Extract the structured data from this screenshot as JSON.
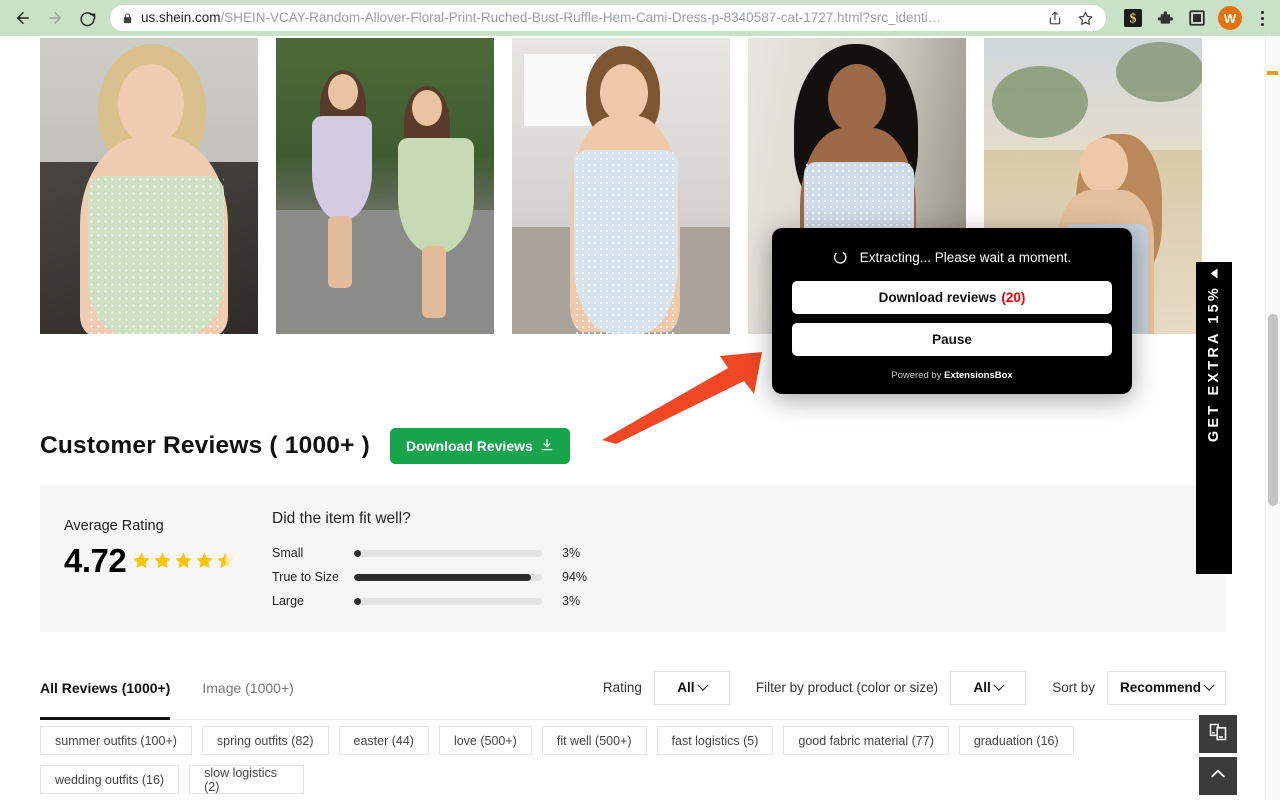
{
  "browser": {
    "back_icon": "back-arrow-icon",
    "forward_icon": "forward-arrow-icon",
    "reload_icon": "reload-icon",
    "lock_icon": "lock-icon",
    "url_domain": "us.shein.com",
    "url_path": "/SHEIN-VCAY-Random-Allover-Floral-Print-Ruched-Bust-Ruffle-Hem-Cami-Dress-p-8340587-cat-1727.html?src_identi…",
    "share_icon": "share-icon",
    "bookmark_icon": "star-icon",
    "extensions": [
      {
        "name": "money-extension-icon",
        "glyph": "$"
      },
      {
        "name": "puzzle-extensions-icon",
        "glyph": "puzzle"
      },
      {
        "name": "side-panel-icon",
        "glyph": "square"
      }
    ],
    "profile_initial": "W",
    "menu_icon": "kebab-menu-icon"
  },
  "gallery": {
    "photos": [
      {
        "name": "review-photo-1",
        "alt": "Blonde woman in sage floral cami dress indoors"
      },
      {
        "name": "review-photo-2",
        "alt": "Two women walking on road in floral dresses"
      },
      {
        "name": "review-photo-3",
        "alt": "Woman in light blue floral dress indoors"
      },
      {
        "name": "review-photo-4",
        "alt": "Dark haired model in light blue floral dress"
      },
      {
        "name": "review-photo-5",
        "alt": "Woman in field at golden hour"
      }
    ]
  },
  "extension_popup": {
    "spinner_icon": "loading-spinner-icon",
    "status": "Extracting... Please wait a moment.",
    "download_label": "Download reviews",
    "download_count": "(20)",
    "pause_label": "Pause",
    "footer_prefix": "Powered by ",
    "footer_brand": "ExtensionsBox",
    "background": "#000000",
    "count_color": "#ee0000"
  },
  "annotation": {
    "arrow_name": "red-pointer-arrow",
    "color": "#f04824"
  },
  "reviews": {
    "title": "Customer Reviews ( 1000+ )",
    "download_button": "Download Reviews",
    "download_icon": "download-icon",
    "download_button_color": "#17a44c",
    "average": {
      "label": "Average Rating",
      "value": "4.72",
      "stars_filled": 4,
      "stars_half": 1,
      "stars_total": 5,
      "star_color": "#ffc400"
    },
    "fit": {
      "question": "Did the item fit well?",
      "rows": [
        {
          "label": "Small",
          "percent": 3,
          "percent_text": "3%"
        },
        {
          "label": "True to Size",
          "percent": 94,
          "percent_text": "94%"
        },
        {
          "label": "Large",
          "percent": 3,
          "percent_text": "3%"
        }
      ]
    },
    "tabs": [
      {
        "label": "All Reviews (1000+)",
        "active": true
      },
      {
        "label": "Image (1000+)",
        "active": false
      }
    ],
    "filters": {
      "rating_label": "Rating",
      "rating_value": "All",
      "product_label": "Filter by product  (color or size)",
      "product_value": "All",
      "sort_label": "Sort by",
      "sort_value": "Recommend"
    },
    "tags": [
      "summer outfits (100+)",
      "spring outfits (82)",
      "easter (44)",
      "love (500+)",
      "fit well (500+)",
      "fast logistics (5)",
      "good fabric material (77)",
      "graduation (16)",
      "wedding outfits (16)",
      "slow logistics (2)"
    ]
  },
  "promo_banner": {
    "text": "GET EXTRA 15%",
    "collapse_icon": "collapse-triangle-icon"
  },
  "floating_buttons": [
    {
      "name": "compare-pages-button",
      "icon": "pages-icon"
    },
    {
      "name": "back-to-top-button",
      "icon": "chevron-up-icon"
    }
  ],
  "scrollbar": {
    "name": "page-scrollbar"
  }
}
